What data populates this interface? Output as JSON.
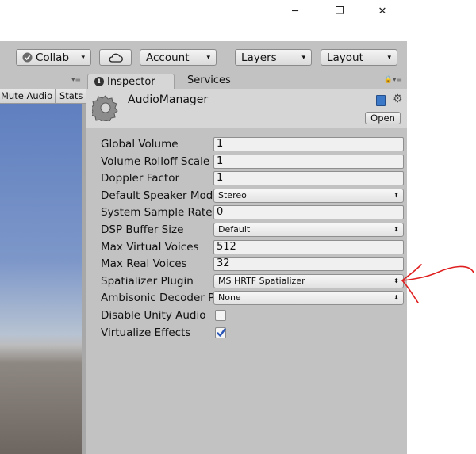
{
  "window": {
    "controls": {
      "minimize": "─",
      "maximize": "❐",
      "close": "✕"
    }
  },
  "toolbar": {
    "collab_label": "Collab",
    "account_label": "Account",
    "layers_label": "Layers",
    "layout_label": "Layout",
    "caret": "▾"
  },
  "left_panel": {
    "mute_audio_label": "Mute Audio",
    "stats_label": "Stats"
  },
  "inspector": {
    "tabs": [
      {
        "label": "Inspector"
      },
      {
        "label": "Services"
      }
    ],
    "object_title": "AudioManager",
    "open_button": "Open",
    "properties": [
      {
        "label": "Global Volume",
        "value": "1",
        "kind": "number"
      },
      {
        "label": "Volume Rolloff Scale",
        "value": "1",
        "kind": "number"
      },
      {
        "label": "Doppler Factor",
        "value": "1",
        "kind": "number"
      },
      {
        "label": "Default Speaker Mode",
        "value": "Stereo",
        "kind": "select"
      },
      {
        "label": "System Sample Rate",
        "value": "0",
        "kind": "number"
      },
      {
        "label": "DSP Buffer Size",
        "value": "Default",
        "kind": "select"
      },
      {
        "label": "Max Virtual Voices",
        "value": "512",
        "kind": "number"
      },
      {
        "label": "Max Real Voices",
        "value": "32",
        "kind": "number"
      },
      {
        "label": "Spatializer Plugin",
        "value": "MS HRTF Spatializer",
        "kind": "select"
      },
      {
        "label": "Ambisonic Decoder Plugin",
        "value": "None",
        "kind": "select"
      },
      {
        "label": "Disable Unity Audio",
        "checked": false,
        "kind": "checkbox"
      },
      {
        "label": "Virtualize Effects",
        "checked": true,
        "kind": "checkbox"
      }
    ],
    "select_arrows": "⬍"
  },
  "colors": {
    "panel_bg": "#c2c2c2",
    "checkmark": "#2a56b8",
    "annotation_red": "#e02020"
  }
}
